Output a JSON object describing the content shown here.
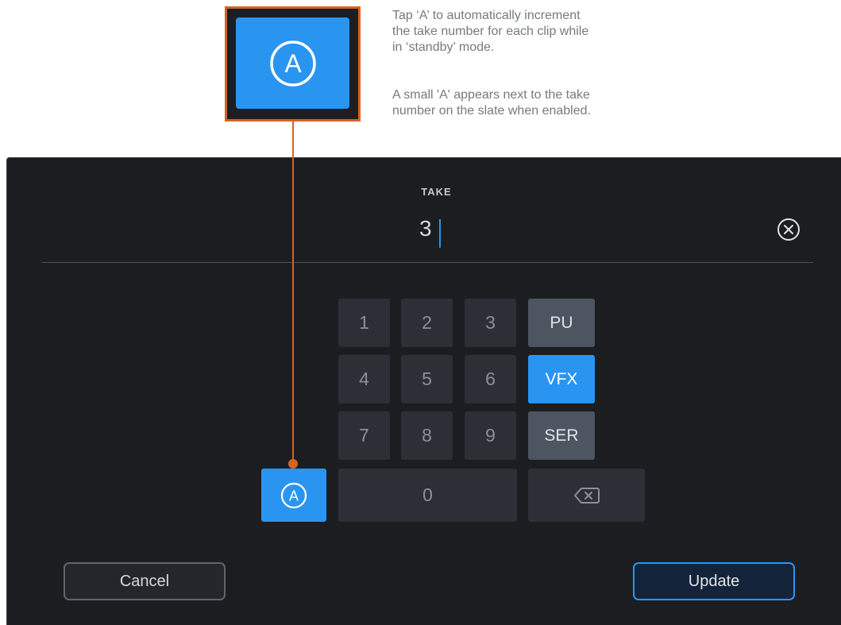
{
  "callout": {
    "paragraph_1": "Tap ‘A’ to automatically increment\nthe take number for each clip while\nin ‘standby’ mode.",
    "paragraph_2": "A small 'A' appears next to the take\nnumber on the slate when enabled."
  },
  "field": {
    "label": "TAKE",
    "value": "3"
  },
  "keypad": {
    "digits": [
      "1",
      "2",
      "3",
      "4",
      "5",
      "6",
      "7",
      "8",
      "9",
      "0"
    ],
    "tags": [
      {
        "label": "PU",
        "active": false
      },
      {
        "label": "VFX",
        "active": true
      },
      {
        "label": "SER",
        "active": false
      }
    ],
    "auto_increment_glyph": "A"
  },
  "buttons": {
    "cancel": "Cancel",
    "update": "Update"
  },
  "colors": {
    "accent": "#2a95f0",
    "callout": "#d8631f",
    "panel": "#1b1d21"
  },
  "icons": [
    "auto-increment-icon",
    "clear-icon",
    "backspace-icon"
  ]
}
